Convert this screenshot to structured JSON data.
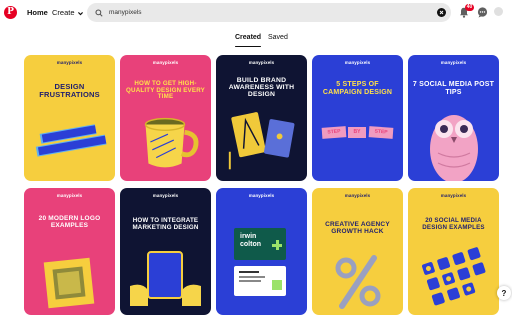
{
  "header": {
    "logo_letter": "P",
    "home_label": "Home",
    "create_label": "Create",
    "search_value": "manypixels",
    "notification_count": "40"
  },
  "tabs": [
    {
      "label": "Created",
      "active": true
    },
    {
      "label": "Saved",
      "active": false
    }
  ],
  "pins": [
    {
      "brand": "manypixels",
      "title": "DESIGN FRUSTRATIONS",
      "bg": "#f6ce3e",
      "text_color": "#1f1f6e",
      "art": "design-frustrations-text"
    },
    {
      "brand": "manypixels",
      "title": "HOW TO GET HIGH-QUALITY DESIGN EVERY TIME",
      "bg": "#e8417a",
      "text_color": "#ffe04a",
      "art": "mug"
    },
    {
      "brand": "manypixels",
      "title": "BUILD BRAND AWARENESS WITH DESIGN",
      "bg": "#0f1433",
      "text_color": "#ffffff",
      "art": "brand-cards"
    },
    {
      "brand": "manypixels",
      "title": "5 STEPS OF CAMPAIGN DESIGN",
      "bg": "#2b3fd6",
      "text_color": "#ffe04a",
      "art": "step-blocks",
      "art_text": [
        "STEP",
        "BY",
        "STEP"
      ]
    },
    {
      "brand": "manypixels",
      "title": "7 SOCIAL MEDIA POST TIPS",
      "bg": "#2b3fd6",
      "text_color": "#ffffff",
      "art": "owl"
    },
    {
      "brand": "manypixels",
      "title": "20 MODERN LOGO EXAMPLES",
      "bg": "#e8417a",
      "text_color": "#ffffff",
      "art": "logo-tile"
    },
    {
      "brand": "manypixels",
      "title": "HOW TO INTEGRATE MARKETING DESIGN",
      "bg": "#0f1433",
      "text_color": "#ffffff",
      "art": "tablet-hands"
    },
    {
      "brand": "manypixels",
      "title": "",
      "bg": "#2b3fd6",
      "text_color": "#ffffff",
      "art": "irwin-colton",
      "art_text": [
        "irwin",
        "colton"
      ]
    },
    {
      "brand": "manypixels",
      "title": "CREATIVE AGENCY GROWTH HACK",
      "bg": "#f6ce3e",
      "text_color": "#1f1f6e",
      "art": "percent"
    },
    {
      "brand": "manypixels",
      "title": "20 SOCIAL MEDIA DESIGN EXAMPLES",
      "bg": "#f6ce3e",
      "text_color": "#1f1f6e",
      "art": "social-icons"
    }
  ],
  "help_label": "?"
}
